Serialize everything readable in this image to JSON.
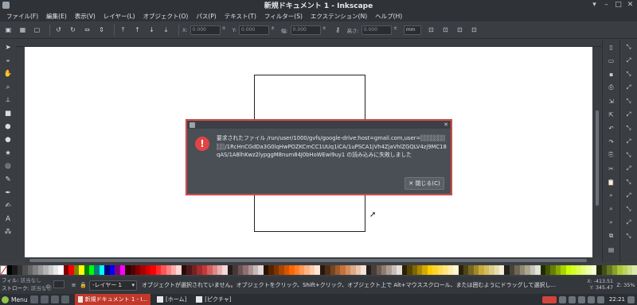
{
  "window": {
    "title": "新規ドキュメント 1 - Inkscape",
    "controls": [
      "▾",
      "–",
      "□",
      "✕"
    ]
  },
  "menubar": {
    "items": [
      "ファイル(F)",
      "編集(E)",
      "表示(V)",
      "レイヤー(L)",
      "オブジェクト(O)",
      "パス(P)",
      "テキスト(T)",
      "フィルター(S)",
      "エクステンション(N)",
      "ヘルプ(H)"
    ]
  },
  "toolbar": {
    "x_label": "X:",
    "x_value": "0.000",
    "y_label": "Y:",
    "y_value": "0.000",
    "w_label": "幅:",
    "w_value": "0.000",
    "h_label": "高さ:",
    "h_value": "0.000",
    "unit": "mm"
  },
  "dialog": {
    "message": "要求されたファイル /run/user/1000/gvfs/google-drive:host=gmail.com,user=░░░░░░░░/1RcHnCGdDa3G0lqHwPOZKCmCC1UUq1iCA/1uPSCA1jVh4ZjaVhlZGQLV4zj9MC18qAS/1A8lhKwz2lypggM8num84J0bHoWEwi9uy1 の読み込みに失敗しました",
    "close_label": "✕ 閉じる(C)",
    "error_glyph": "!"
  },
  "palette": {
    "colors": [
      "#000000",
      "#1a1a1a",
      "#333333",
      "#4d4d4d",
      "#666666",
      "#808080",
      "#999999",
      "#b3b3b3",
      "#cccccc",
      "#e6e6e6",
      "#ffffff",
      "#800000",
      "#ff0000",
      "#808000",
      "#ffff00",
      "#008000",
      "#00ff00",
      "#008080",
      "#00ffff",
      "#000080",
      "#0000ff",
      "#800080",
      "#ff00ff",
      "#2b0000",
      "#550000",
      "#800000",
      "#aa0000",
      "#d40000",
      "#ff0000",
      "#ff2a2a",
      "#ff5555",
      "#ff8080",
      "#ffaaaa",
      "#ffd5d5",
      "#280b0b",
      "#501616",
      "#782121",
      "#a02c2c",
      "#c83737",
      "#d35f5f",
      "#de8787",
      "#e9afaf",
      "#f4d7d7",
      "#241c1c",
      "#483737",
      "#6c5353",
      "#916f6f",
      "#ac9393",
      "#c8b7b7",
      "#e3dbdb",
      "#2b1100",
      "#552200",
      "#803300",
      "#aa4400",
      "#d45500",
      "#ff6600",
      "#ff7f2a",
      "#ff9955",
      "#ffb380",
      "#ffccaa",
      "#ffe6d5",
      "#28170b",
      "#502d16",
      "#784421",
      "#a05a2c",
      "#c87137",
      "#d38d5f",
      "#deaa87",
      "#e9c6af",
      "#f4e3d7",
      "#241f1c",
      "#483e37",
      "#6c5d53",
      "#917c6f",
      "#ac9d93",
      "#c8beb7",
      "#e3dedb",
      "#2b2200",
      "#554400",
      "#806600",
      "#aa8800",
      "#d4aa00",
      "#ffcc00",
      "#ffd42a",
      "#ffdd55",
      "#ffe680",
      "#ffeeaa",
      "#fff6d5",
      "#28220b",
      "#504416",
      "#786721",
      "#a0892c",
      "#c8ab37",
      "#d3bc5f",
      "#decd87",
      "#e9ddaf",
      "#f4eed7",
      "#24221c",
      "#484537",
      "#6c6753",
      "#918a6f",
      "#aca793",
      "#c8c4b7",
      "#e3e2db",
      "#222b00",
      "#445500",
      "#668000",
      "#88aa00",
      "#aad400",
      "#ccff00",
      "#d4ff2a",
      "#ddff55",
      "#e5ff80",
      "#eeffaa",
      "#f6ffd5",
      "#22280b",
      "#445016",
      "#677821",
      "#89a02c",
      "#abc837",
      "#bcd35f",
      "#cdde87",
      "#dde9af"
    ]
  },
  "statusbar": {
    "fill_label": "フィル:",
    "fill_value": "該当なし",
    "stroke_label": "ストローク:",
    "stroke_value": "該当なし",
    "opacity_label": "O:",
    "layer_name": "-レイヤー 1",
    "message": "オブジェクトが選択されていません。オブジェクトをクリック、Shift+クリック、オブジェクト上で Alt+マウススクロール、または囲むようにドラッグして選択し...",
    "x_label": "X:",
    "x_value": "-413.51",
    "y_label": "Y:",
    "y_value": "345.47",
    "zoom_label": "Z:",
    "zoom_value": "35%"
  },
  "taskbar": {
    "menu_label": "Menu",
    "tasks": [
      "新規ドキュメント 1 - I...",
      "[ホーム]",
      "[ピクチャ]"
    ],
    "clock": "22:21"
  }
}
